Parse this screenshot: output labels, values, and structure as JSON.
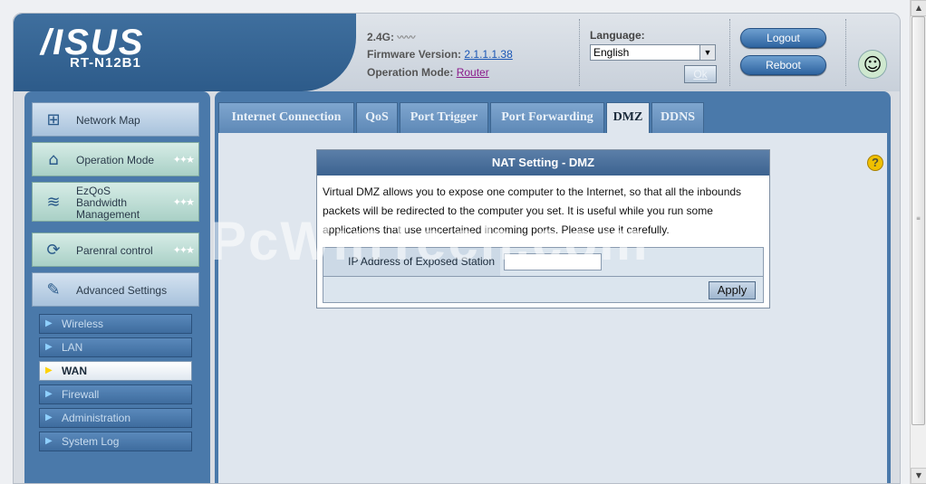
{
  "header": {
    "logo": "/ISUS",
    "model": "RT-N12B1",
    "band_label": "2.4G:",
    "firmware_label": "Firmware Version:",
    "firmware_value": "2.1.1.1.38",
    "opmode_label": "Operation Mode:",
    "opmode_value": "Router",
    "language_label": "Language:",
    "language_value": "English",
    "ok_label": "Ok",
    "logout_label": "Logout",
    "reboot_label": "Reboot"
  },
  "sidebar": {
    "items": [
      {
        "label": "Network Map",
        "icon": "network-map-icon"
      },
      {
        "label": "Operation Mode",
        "icon": "router-icon"
      },
      {
        "label": "EzQoS Bandwidth Management",
        "icon": "bandwidth-icon"
      },
      {
        "label": "Parenral control",
        "icon": "parental-control-icon"
      },
      {
        "label": "Advanced Settings",
        "icon": "tools-icon"
      }
    ],
    "sub_items": [
      {
        "label": "Wireless"
      },
      {
        "label": "LAN"
      },
      {
        "label": "WAN"
      },
      {
        "label": "Firewall"
      },
      {
        "label": "Administration"
      },
      {
        "label": "System Log"
      }
    ]
  },
  "tabs": [
    {
      "label": "Internet Connection"
    },
    {
      "label": "QoS"
    },
    {
      "label": "Port Trigger"
    },
    {
      "label": "Port Forwarding"
    },
    {
      "label": "DMZ"
    },
    {
      "label": "DDNS"
    }
  ],
  "nat": {
    "title": "NAT Setting - DMZ",
    "description": "Virtual DMZ allows you to expose one computer to the Internet, so that all the inbounds packets will be redirected to the computer you set. It is useful while you run some applications that use uncertained incoming ports. Please use it carefully.",
    "ip_label": "IP Address of Exposed Station",
    "ip_value": "",
    "apply_label": "Apply"
  },
  "watermark": "PcWinTech.com",
  "colors": {
    "accent": "#4a79aa",
    "tab_active": "#dfe6ee",
    "title_bar": "#3c6390"
  }
}
